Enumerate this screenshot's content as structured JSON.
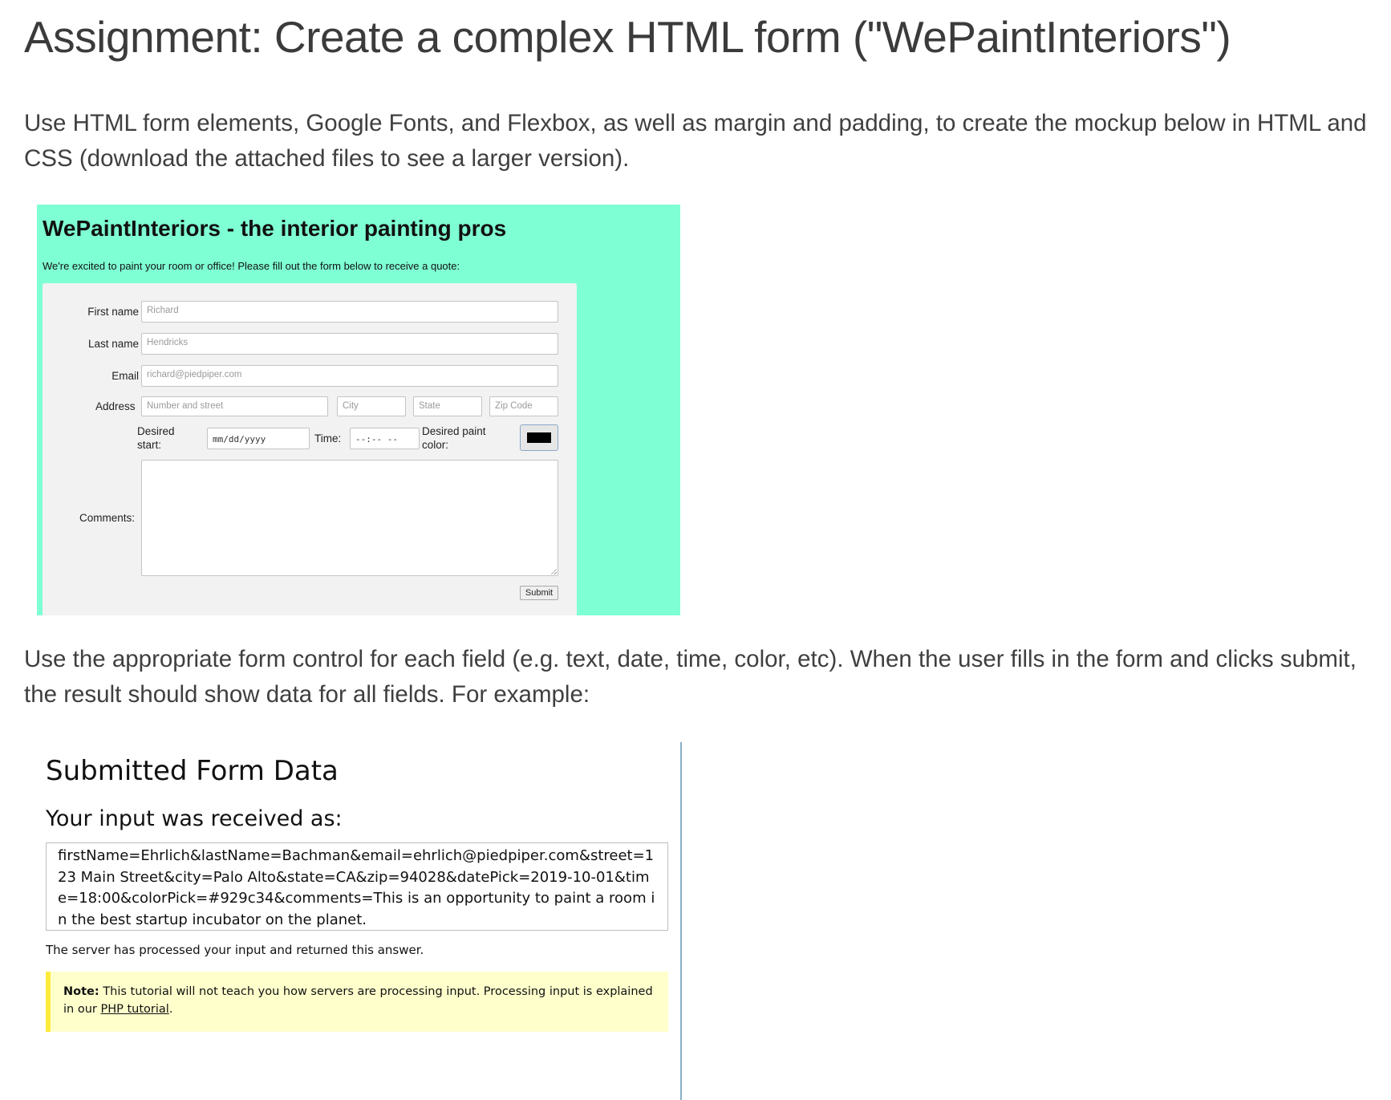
{
  "assignment": {
    "title": "Assignment: Create a complex HTML form (\"WePaintInteriors\")",
    "intro": "Use HTML form elements, Google Fonts, and Flexbox, as well as margin and padding, to create the mockup below in HTML and CSS (download the attached files to see a larger version).",
    "instructions": "Use the appropriate form control for each field (e.g. text, date, time, color, etc). When the user fills in the form and clicks submit, the result should show data for all fields.  For example:"
  },
  "mockup": {
    "background": "#7fffd4",
    "title": "WePaintInteriors - the interior painting pros",
    "intro": "We're excited to paint your room or office! Please fill out the form below to receive a quote:",
    "fields": {
      "first_name": {
        "label": "First name",
        "placeholder": "Richard"
      },
      "last_name": {
        "label": "Last name",
        "placeholder": "Hendricks"
      },
      "email": {
        "label": "Email",
        "placeholder": "richard@piedpiper.com"
      },
      "address": {
        "label": "Address",
        "street_placeholder": "Number and street",
        "city_placeholder": "City",
        "state_placeholder": "State",
        "zip_placeholder": "Zip Code"
      },
      "desired_start": {
        "label_line1": "Desired",
        "label_line2": "start:",
        "placeholder": "mm/dd/yyyy"
      },
      "time": {
        "label": "Time:",
        "placeholder": "--:-- --"
      },
      "paint_color": {
        "label_line1": "Desired paint",
        "label_line2": "color:",
        "value": "#000000"
      },
      "comments": {
        "label": "Comments:"
      }
    },
    "submit_label": "Submit"
  },
  "result": {
    "title": "Submitted Form Data",
    "subtitle": "Your input was received as:",
    "output": "firstName=Ehrlich&lastName=Bachman&email=ehrlich@piedpiper.com&street=123 Main Street&city=Palo Alto&state=CA&zip=94028&datePick=2019-10-01&time=18:00&colorPick=#929c34&comments=This is an opportunity to paint a room in the best startup incubator on the planet.",
    "processed": "The server has processed your input and returned this answer.",
    "note": {
      "label": "Note:",
      "text": "This tutorial will not teach you how servers are processing input. Processing input is explained in our",
      "link": "PHP tutorial",
      "suffix": "."
    }
  }
}
